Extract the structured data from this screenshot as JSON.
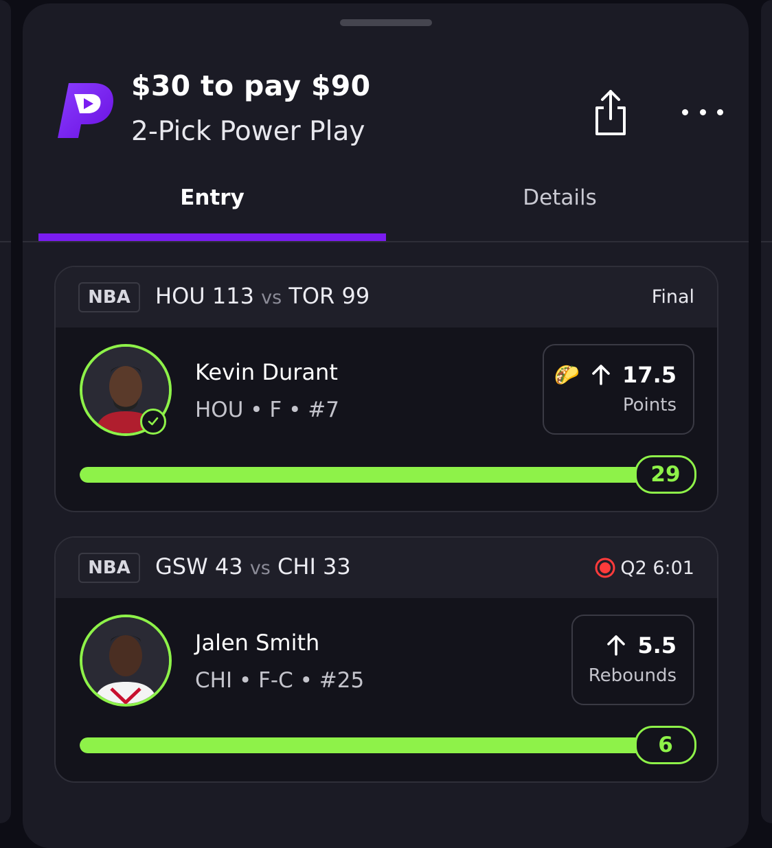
{
  "entry": {
    "title": "$30 to pay $90",
    "subtitle": "2-Pick Power Play"
  },
  "tabs": [
    {
      "label": "Entry",
      "active": true
    },
    {
      "label": "Details",
      "active": false
    }
  ],
  "picks": [
    {
      "league": "NBA",
      "home_team": "HOU",
      "home_score": "113",
      "vs": "vs",
      "away_team": "TOR",
      "away_score": "99",
      "status": "Final",
      "live": false,
      "player_name": "Kevin Durant",
      "player_meta": "HOU • F • #7",
      "emoji": "🌮",
      "line": "17.5",
      "stat": "Points",
      "direction": "up-arrow-icon",
      "current_value": "29",
      "progress_fraction": 1.0,
      "hit": true
    },
    {
      "league": "NBA",
      "home_team": "GSW",
      "home_score": "43",
      "vs": "vs",
      "away_team": "CHI",
      "away_score": "33",
      "status": "Q2 6:01",
      "live": true,
      "player_name": "Jalen Smith",
      "player_meta": "CHI • F-C • #25",
      "line": "5.5",
      "stat": "Rebounds",
      "direction": "up-arrow-icon",
      "current_value": "6",
      "progress_fraction": 1.0,
      "hit": true
    }
  ],
  "colors": {
    "accent_purple": "#7a1cf0",
    "progress_green": "#8ef249",
    "live_red": "#ff3b3b",
    "background": "#1b1b25"
  }
}
